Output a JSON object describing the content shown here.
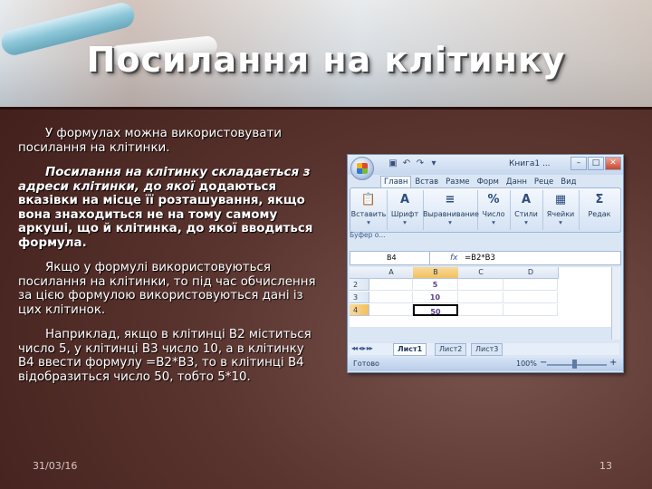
{
  "title": "Посилання на клітинку",
  "paragraphs": [
    {
      "text": "У формулах можна використовувати посилання на клітинки."
    },
    {
      "emph": "Посилання на клітинку складається з адреси клітинки, до якої",
      "rest": " додаються вказівки на місце її розташування, якщо вона знаходиться не на тому самому аркуші, що й клітинка, до якої вводиться формула."
    },
    {
      "text": "Якщо у формулі використовуються посилання на клітинки, то під час обчислення за цією формулою використовуються дані із цих клітинок."
    },
    {
      "text": "Наприклад, якщо в клітинці B2 міститься число 5, у клітинці B3 число 10, а в клітинку B4 ввести формулу =B2*B3, то в клітинці B4 відобразиться число 50, тобто 5*10."
    }
  ],
  "footer": {
    "date": "31/03/16",
    "page": "13"
  },
  "excel": {
    "window_title": "Книга1 ...",
    "tabs": [
      "Главн",
      "Встав",
      "Разме",
      "Форм",
      "Данн",
      "Реце",
      "Вид"
    ],
    "ribbon_groups": [
      {
        "icon": "📋",
        "label": "Вставить",
        "sub": "▾"
      },
      {
        "icon": "A",
        "label": "Шрифт",
        "sub": "▾"
      },
      {
        "icon": "≡",
        "label": "Выравнивание",
        "sub": "▾"
      },
      {
        "icon": "%",
        "label": "Число",
        "sub": "▾"
      },
      {
        "icon": "A",
        "label": "Стили",
        "sub": "▾"
      },
      {
        "icon": "▦",
        "label": "Ячейки",
        "sub": "▾"
      },
      {
        "icon": "Σ",
        "label": "Редак",
        "sub": ""
      }
    ],
    "clipboard_label": "Буфер о...",
    "name_box": "B4",
    "fx": "fx",
    "formula": "=B2*B3",
    "columns": [
      "",
      "A",
      "B",
      "C",
      "D"
    ],
    "rows": [
      {
        "num": "2",
        "b": "5"
      },
      {
        "num": "3",
        "b": "10"
      },
      {
        "num": "4",
        "b": "50"
      }
    ],
    "sheets": [
      "Лист1",
      "Лист2",
      "Лист3"
    ],
    "sheet_nav": "◂◂ ◂ ▸ ▸▸",
    "status_ready": "Готово",
    "zoom": "100%",
    "accent": "#5a3b8c"
  }
}
